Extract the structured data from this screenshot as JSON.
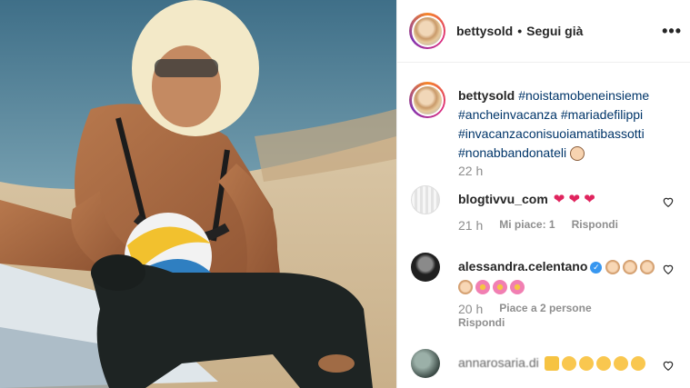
{
  "post": {
    "author": "bettysold",
    "separator": "•",
    "follow_status": "Segui già",
    "more_symbol": "•••"
  },
  "caption": {
    "user": "bettysold",
    "hashtags": [
      "#noistamobeneinsieme",
      "#ancheinvacanza",
      "#mariadefilippi",
      "#invacanzaconisuoiamatibassotti",
      "#nonabbandonateli"
    ],
    "time": "22 h"
  },
  "comments": [
    {
      "user": "blogtivvu_com",
      "text": "❤ ❤ ❤",
      "time": "21 h",
      "likes": "Mi piace: 1",
      "reply": "Rispondi"
    },
    {
      "user": "alessandra.celentano",
      "time": "20 h",
      "likes": "Piace a 2 persone",
      "reply": "Rispondi"
    },
    {
      "user": "annarosaria.di"
    }
  ],
  "colors": {
    "hashtag": "#003569",
    "muted": "#8e8e8e",
    "text": "#262626",
    "verified": "#3897f0"
  }
}
